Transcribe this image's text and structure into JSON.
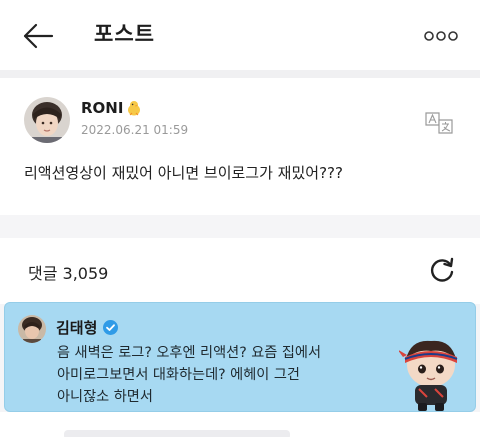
{
  "header": {
    "title": "포스트",
    "back_icon": "arrow-left-icon",
    "more_icon": "more-horizontal-icon"
  },
  "post": {
    "author": "RONI",
    "author_emoji": "chick-icon",
    "date": "2022.06.21 01:59",
    "text": "리액션영상이 재밌어 아니면 브이로그가 재밌어???",
    "translate_icon": "translate-icon"
  },
  "comments": {
    "count_label": "댓글 3,059",
    "refresh_icon": "refresh-icon",
    "items": [
      {
        "author": "김태형",
        "verified": true,
        "lines": [
          "음 새벽은 로그? 오후엔 리액션? 요즘 집에서",
          "아미로그보면서 대화하는데? 에헤이 그건",
          "아니잖소 하면서"
        ],
        "sticker": "bt21-character-sticker",
        "card_color": "#a7d9f2"
      }
    ]
  }
}
